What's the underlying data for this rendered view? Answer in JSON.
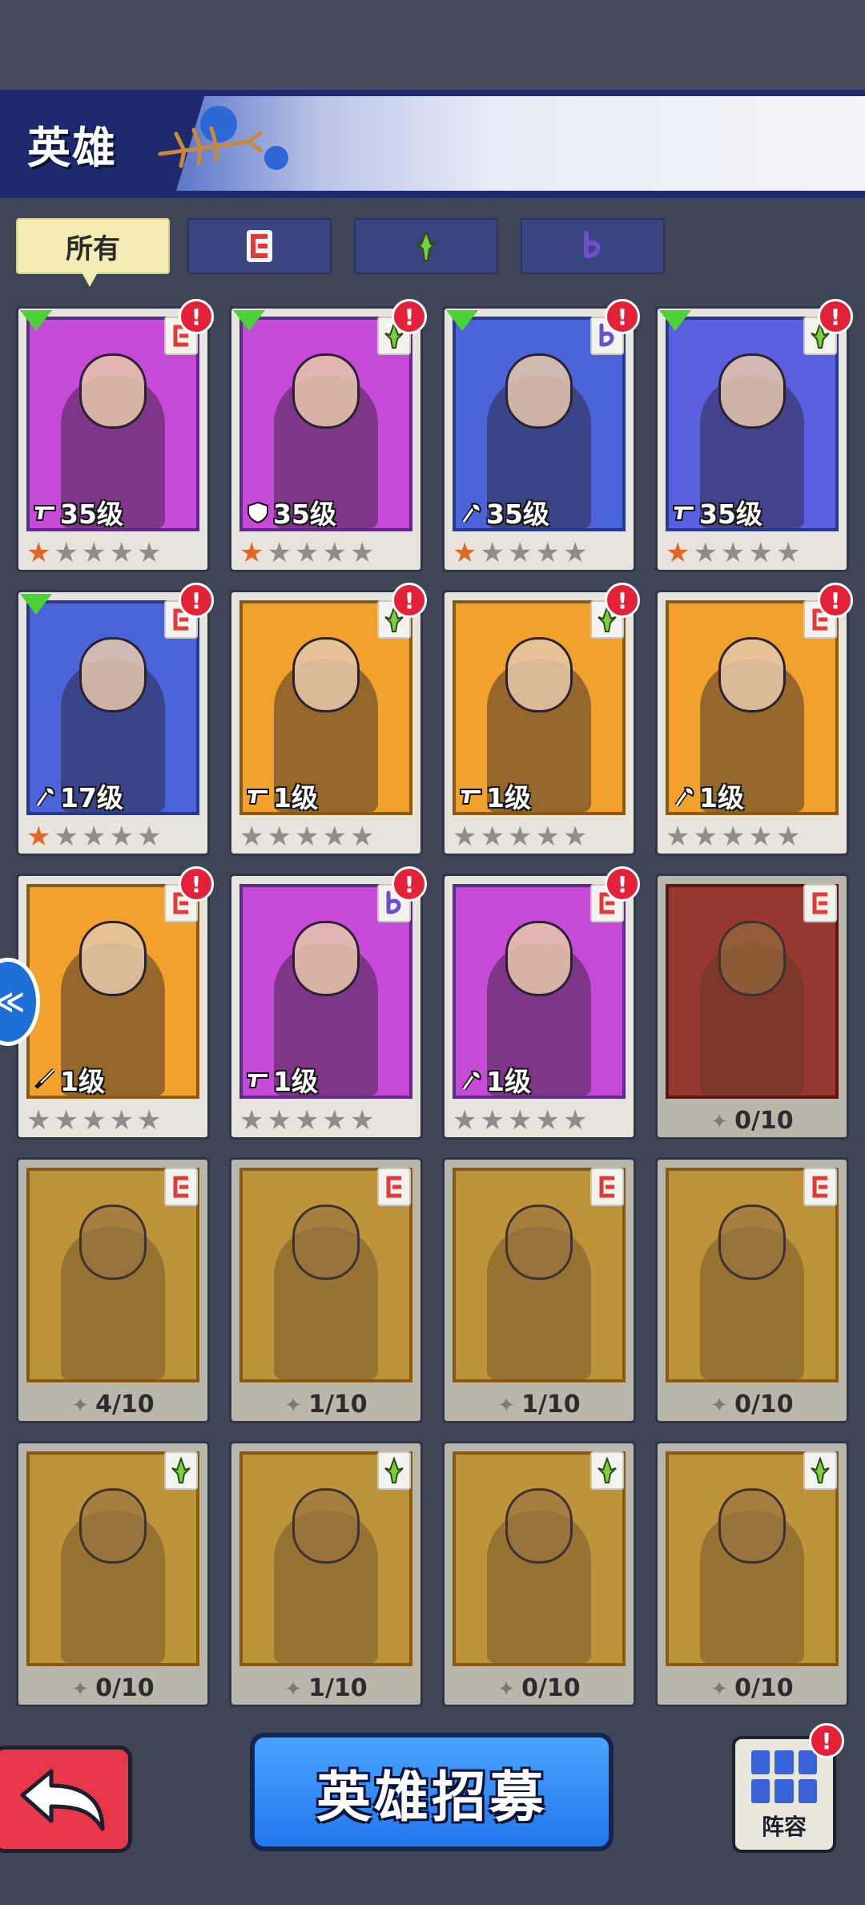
{
  "header": {
    "title": "英雄"
  },
  "filters": [
    {
      "label": "所有",
      "active": true
    },
    {
      "icon": "c-class-icon",
      "color": "#e23a3a"
    },
    {
      "icon": "dagger-class-icon",
      "color": "#7ccf3e"
    },
    {
      "icon": "b-class-icon",
      "color": "#6a4fcf"
    }
  ],
  "heroes": [
    {
      "level": "35级",
      "weapon": "pistol",
      "cls": "c",
      "color": "#c64ad8",
      "border": "#5b2c8e",
      "new": true,
      "alert": true,
      "stars": 1
    },
    {
      "level": "35级",
      "weapon": "shield",
      "cls": "dagger",
      "color": "#c64ad8",
      "border": "#5b2c8e",
      "new": true,
      "alert": true,
      "stars": 1
    },
    {
      "level": "35级",
      "weapon": "axe",
      "cls": "b",
      "color": "#4a63d8",
      "border": "#263a93",
      "new": true,
      "alert": true,
      "stars": 1
    },
    {
      "level": "35级",
      "weapon": "pistol",
      "cls": "dagger",
      "color": "#5a5fe0",
      "border": "#263a93",
      "new": true,
      "alert": true,
      "stars": 1
    },
    {
      "level": "17级",
      "weapon": "axe",
      "cls": "c",
      "color": "#4a63d8",
      "border": "#263a93",
      "new": true,
      "alert": true,
      "stars": 1
    },
    {
      "level": "1级",
      "weapon": "pistol",
      "cls": "dagger",
      "color": "#f0a22c",
      "border": "#8a5a10",
      "new": false,
      "alert": true,
      "stars": 0
    },
    {
      "level": "1级",
      "weapon": "pistol",
      "cls": "dagger",
      "color": "#f0a22c",
      "border": "#8a5a10",
      "new": false,
      "alert": true,
      "stars": 0
    },
    {
      "level": "1级",
      "weapon": "axe",
      "cls": "c",
      "color": "#f0a22c",
      "border": "#8a5a10",
      "new": false,
      "alert": true,
      "stars": 0
    },
    {
      "level": "1级",
      "weapon": "dagger",
      "cls": "c",
      "color": "#f0a22c",
      "border": "#8a5a10",
      "new": false,
      "alert": true,
      "stars": 0
    },
    {
      "level": "1级",
      "weapon": "pistol",
      "cls": "b",
      "color": "#c64ad8",
      "border": "#5b2c8e",
      "new": false,
      "alert": true,
      "stars": 0
    },
    {
      "level": "1级",
      "weapon": "axe",
      "cls": "c",
      "color": "#c64ad8",
      "border": "#5b2c8e",
      "new": false,
      "alert": true,
      "stars": 0
    },
    {
      "shards": "0/10",
      "cls": "c",
      "color": "#a12a2a",
      "border": "#5a1616",
      "locked": true
    },
    {
      "shards": "4/10",
      "cls": "c",
      "color": "#d6a43a",
      "border": "#8a5a10",
      "locked": true
    },
    {
      "shards": "1/10",
      "cls": "c",
      "color": "#d6a43a",
      "border": "#8a5a10",
      "locked": true
    },
    {
      "shards": "1/10",
      "cls": "c",
      "color": "#d6a43a",
      "border": "#8a5a10",
      "locked": true
    },
    {
      "shards": "0/10",
      "cls": "c",
      "color": "#d6a43a",
      "border": "#8a5a10",
      "locked": true
    },
    {
      "shards": "0/10",
      "cls": "dagger",
      "color": "#d6a43a",
      "border": "#8a5a10",
      "locked": true
    },
    {
      "shards": "1/10",
      "cls": "dagger",
      "color": "#d6a43a",
      "border": "#8a5a10",
      "locked": true
    },
    {
      "shards": "0/10",
      "cls": "dagger",
      "color": "#d6a43a",
      "border": "#8a5a10",
      "locked": true
    },
    {
      "shards": "0/10",
      "cls": "dagger",
      "color": "#d6a43a",
      "border": "#8a5a10",
      "locked": true
    }
  ],
  "buttons": {
    "recruit_label": "英雄招募",
    "lineup_label": "阵容"
  },
  "colors": {
    "alert": "#e3223a",
    "new": "#4cd137",
    "accent": "#2377ee"
  }
}
